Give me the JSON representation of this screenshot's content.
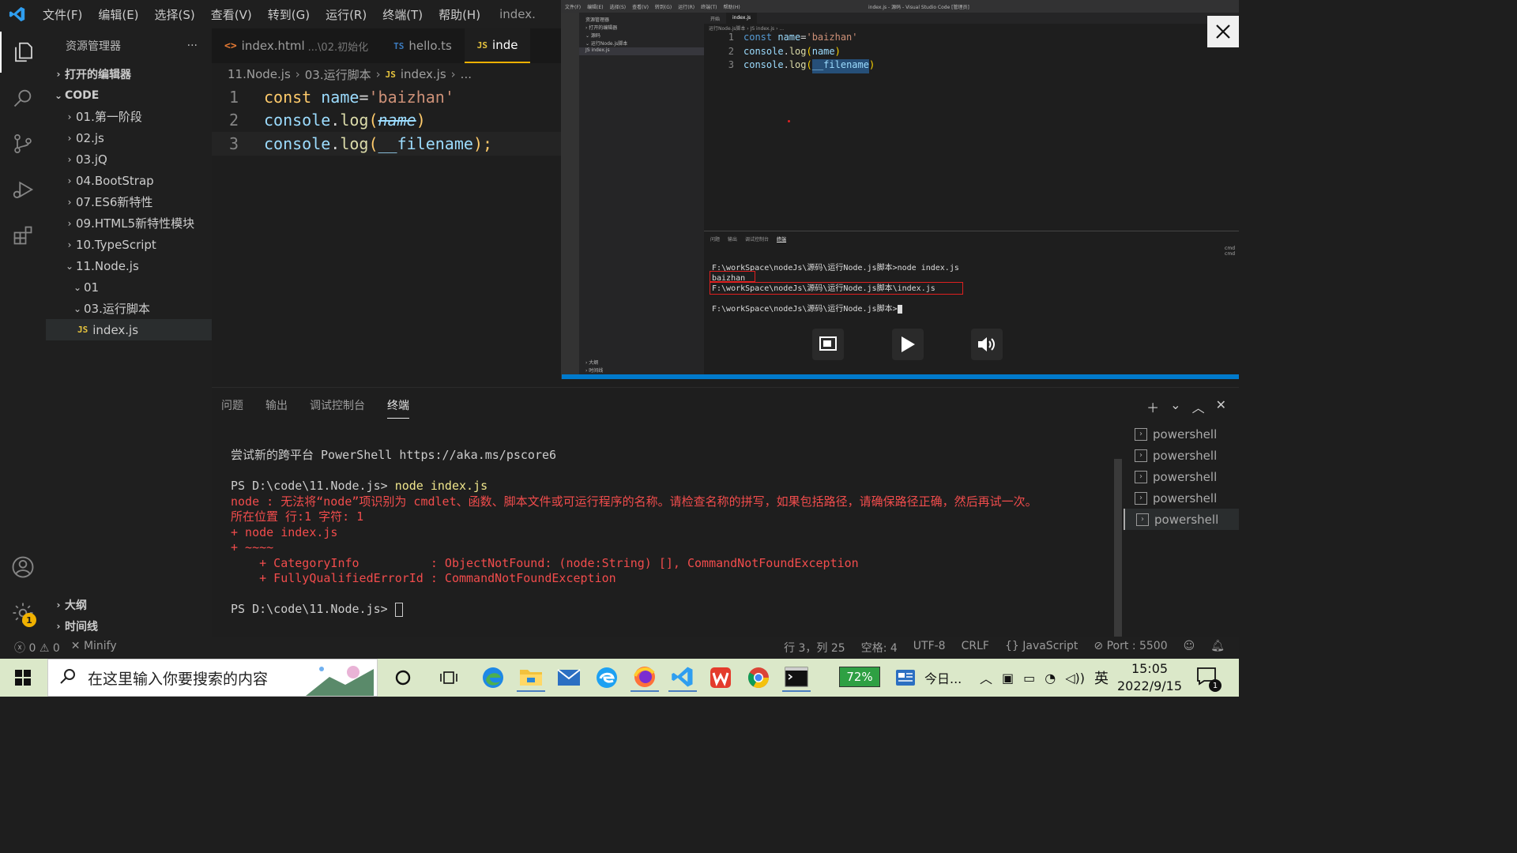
{
  "titlebar": {
    "menus": [
      "文件(F)",
      "编辑(E)",
      "选择(S)",
      "查看(V)",
      "转到(G)",
      "运行(R)",
      "终端(T)",
      "帮助(H)"
    ],
    "window_title": "index."
  },
  "sidebar": {
    "title": "资源管理器",
    "more": "···",
    "open_editors": "打开的编辑器",
    "workspace": "CODE",
    "folders": [
      "01.第一阶段",
      "02.js",
      "03.jQ",
      "04.BootStrap",
      "07.ES6新特性",
      "09.HTML5新特性模块",
      "10.TypeScript"
    ],
    "node_folder": "11.Node.js",
    "sub_folder_01": "01",
    "sub_folder_run": "03.运行脚本",
    "selected_file": "index.js",
    "outline": "大纲",
    "timeline": "时间线"
  },
  "tabs": [
    {
      "icon": "<>",
      "label": "index.html",
      "sub": "...\\02.初始化"
    },
    {
      "icon": "TS",
      "label": "hello.ts",
      "sub": ""
    },
    {
      "icon": "JS",
      "label": "inde",
      "sub": ""
    }
  ],
  "breadcrumb": {
    "p1": "11.Node.js",
    "p2": "03.运行脚本",
    "icon": "JS",
    "p3": "index.js",
    "p4": "..."
  },
  "editor": {
    "line_numbers": [
      "1",
      "2",
      "3"
    ],
    "l1_kw": "const",
    "l1_name": " name",
    "l1_eq": "=",
    "l1_str": "'baizhan'",
    "l2_obj": "console",
    "l2_dot": ".",
    "l2_fn": "log",
    "l2_open": "(",
    "l2_arg": "name",
    "l2_close": ")",
    "l3_obj": "console",
    "l3_dot": ".",
    "l3_fn": "log",
    "l3_open": "(",
    "l3_arg": "__filename",
    "l3_close": ");"
  },
  "panel": {
    "tabs": [
      "问题",
      "输出",
      "调试控制台",
      "终端"
    ],
    "active_tab": "终端",
    "shells": [
      "powershell",
      "powershell",
      "powershell",
      "powershell",
      "powershell"
    ],
    "terminal": {
      "hint": "尝试新的跨平台 PowerShell https://aka.ms/pscore6",
      "prompt1": "PS D:\\code\\11.Node.js> ",
      "cmd1": "node index.js",
      "err1": "node : 无法将“node”项识别为 cmdlet、函数、脚本文件或可运行程序的名称。请检查名称的拼写，如果包括路径，请确保路径正确，然后再试一次。",
      "err2": "所在位置 行:1 字符: 1",
      "err3": "+ node index.js",
      "err4": "+ ~~~~",
      "err5": "    + CategoryInfo          : ObjectNotFound: (node:String) [], CommandNotFoundException",
      "err6": "    + FullyQualifiedErrorId : CommandNotFoundException",
      "prompt2": "PS D:\\code\\11.Node.js> "
    }
  },
  "statusbar": {
    "errors": "0",
    "warnings": "0",
    "minify": "Minify",
    "position": "行 3，列 25",
    "spaces": "空格: 4",
    "encoding": "UTF-8",
    "eol": "CRLF",
    "language": "JavaScript",
    "port": "Port : 5500"
  },
  "video": {
    "title": "index.js - 源码 - Visual Studio Code [管理员]",
    "menus": [
      "文件(F)",
      "编辑(E)",
      "选择(S)",
      "查看(V)",
      "转到(G)",
      "运行(R)",
      "终端(T)",
      "帮助(H)"
    ],
    "side_title": "资源管理器",
    "side_items": [
      "› 打开的编辑器",
      "⌄ 源码",
      "  ⌄ 运行Node.js脚本",
      "     JS index.js"
    ],
    "side_bottom": [
      "› 大纲",
      "› 时间线"
    ],
    "tabs": [
      "开始",
      "index.js"
    ],
    "crumb": "运行Node.js脚本 › JS index.js › ...",
    "code_nums": [
      "1",
      "2",
      "3"
    ],
    "c1a": "const",
    "c1b": " name",
    "c1c": "=",
    "c1d": "'baizhan'",
    "c2a": "console",
    "c2b": ".",
    "c2c": "log",
    "c2d": "(",
    "c2e": "name",
    "c2f": ")",
    "c3a": "console",
    "c3b": ".",
    "c3c": "log",
    "c3d": "(",
    "c3e": "__filename",
    "c3f": ")",
    "panel_tabs": [
      "问题",
      "输出",
      "调试控制台",
      "终端"
    ],
    "term1": "F:\\workSpace\\nodeJs\\源码\\运行Node.js脚本>node index.js",
    "term2": "baizhan",
    "term3": "F:\\workSpace\\nodeJs\\源码\\运行Node.js脚本\\index.js",
    "term4": "F:\\workSpace\\nodeJs\\源码\\运行Node.js脚本>",
    "shells": [
      "cmd",
      "cmd"
    ]
  },
  "taskbar": {
    "search_placeholder": "在这里输入你要搜索的内容",
    "battery": "72%",
    "news": "今日...",
    "ime": "英",
    "time": "15:05",
    "date": "2022/9/15",
    "notif_count": "1"
  }
}
